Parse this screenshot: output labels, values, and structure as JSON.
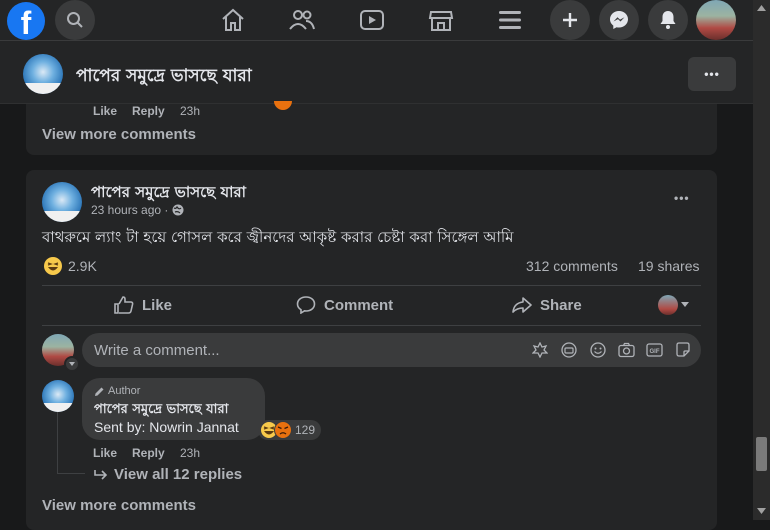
{
  "topnav": {
    "logo": "f",
    "icons": [
      "search-icon",
      "home-icon",
      "friends-icon",
      "watch-icon",
      "marketplace-icon",
      "menu-icon",
      "create-icon",
      "messenger-icon",
      "notifications-icon"
    ]
  },
  "header": {
    "page_name": "পাপের সমুদ্রে ভাসছে যারা",
    "more_label": "•••"
  },
  "prev_post": {
    "like": "Like",
    "reply": "Reply",
    "time": "23h",
    "view_more": "View more comments"
  },
  "post": {
    "author": "পাপের সমুদ্রে ভাসছে যারা",
    "time": "23 hours ago ·",
    "text": "বাথরুমে ল্যাং টা হয়ে গোসল করে জ্বীনদের আকৃষ্ট করার চেষ্টা করা সিঙ্গেল আমি",
    "reactions": "2.9K",
    "comments": "312 comments",
    "shares": "19 shares",
    "actions": {
      "like": "Like",
      "comment": "Comment",
      "share": "Share"
    },
    "more_label": "•••"
  },
  "composer": {
    "placeholder": "Write a comment..."
  },
  "comment": {
    "badge": "Author",
    "name": "পাপের সমুদ্রে ভাসছে যারা",
    "text": "Sent by: Nowrin Jannat",
    "reaction_count": "129",
    "like": "Like",
    "reply": "Reply",
    "time": "23h",
    "view_replies": "View all 12 replies"
  },
  "footer": {
    "view_more": "View more comments"
  },
  "colors": {
    "accent": "#1877f2",
    "haha": "#f7c94b",
    "angry": "#e9710f"
  }
}
